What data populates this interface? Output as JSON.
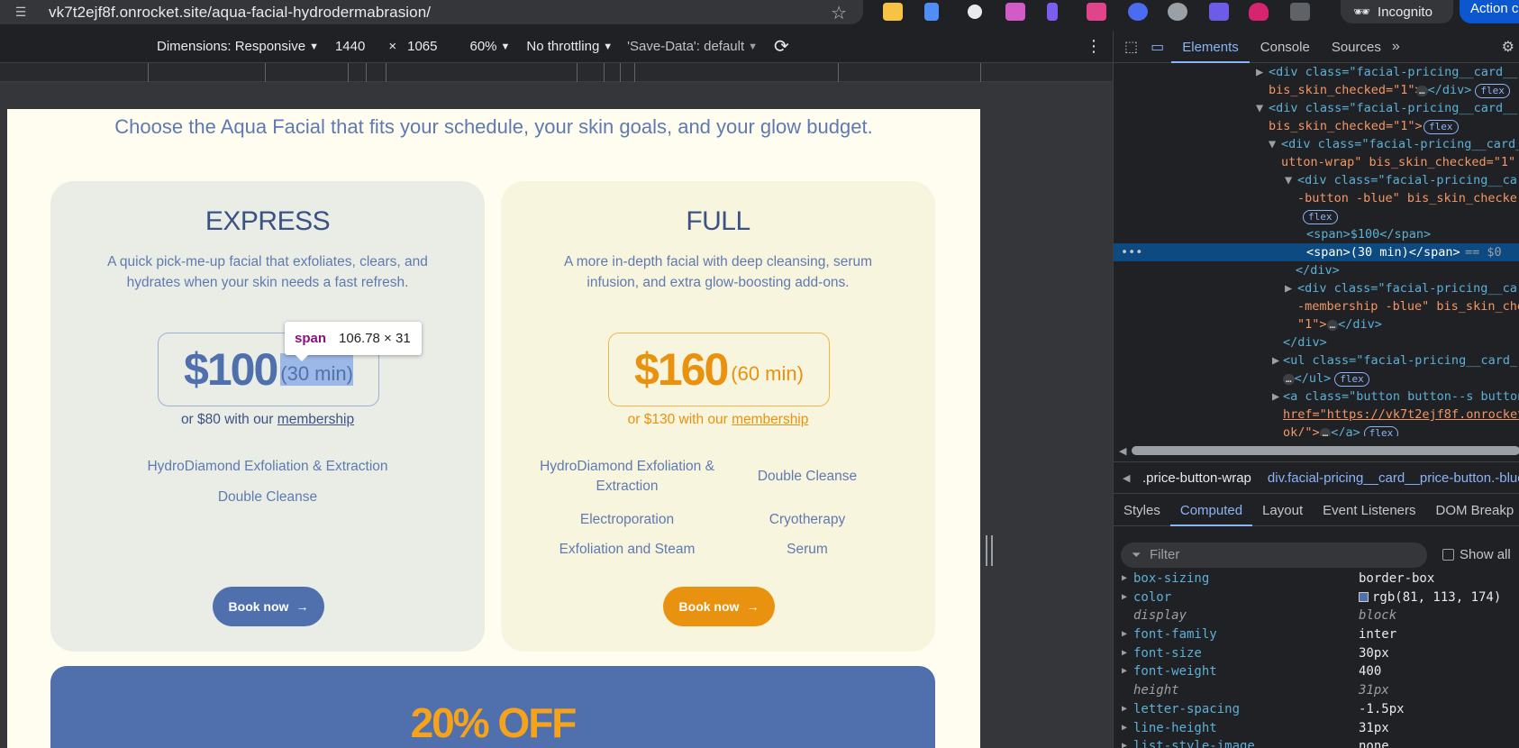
{
  "browser": {
    "url": "vk7t2ejf8f.onrocket.site/aqua-facial-hydrodermabrasion/",
    "incognito_label": "Incognito",
    "action_label": "Action c"
  },
  "device_toolbar": {
    "dimensions": "Dimensions: Responsive",
    "width": "1440",
    "times": "×",
    "height": "1065",
    "zoom": "60%",
    "throttling": "No throttling",
    "save_data": "'Save-Data': default"
  },
  "page": {
    "lede": "Choose the Aqua Facial that fits your schedule, your skin goals, and your glow budget.",
    "express": {
      "title": "EXPRESS",
      "desc": "A quick pick-me-up facial that exfoliates, clears, and hydrates when your skin needs a fast refresh.",
      "price": "$100",
      "duration": "(30 min)",
      "member_prefix": "or $80 with our",
      "member_link": "membership",
      "features": [
        "HydroDiamond Exfoliation & Extraction",
        "Double Cleanse"
      ],
      "book": "Book now"
    },
    "full": {
      "title": "FULL",
      "desc": "A more in-depth facial with deep cleansing, serum infusion, and extra glow-boosting add-ons.",
      "price": "$160",
      "duration": "(60 min)",
      "member_prefix": "or $130 with our",
      "member_link": "membership",
      "features": [
        "HydroDiamond Exfoliation & Extraction",
        "Double Cleanse",
        "Electroporation",
        "Cryotherapy",
        "Exfoliation and Steam",
        "Serum"
      ],
      "book": "Book now"
    },
    "promo": "20% OFF"
  },
  "tooltip": {
    "tag": "span",
    "size": "106.78 × 31"
  },
  "devtools": {
    "tabs": [
      "Elements",
      "Console",
      "Sources"
    ],
    "breadcrumb_1": ".price-button-wrap",
    "breadcrumb_2": "div.facial-pricing__card__price-button.-blue",
    "sub_tabs": [
      "Styles",
      "Computed",
      "Layout",
      "Event Listeners",
      "DOM Breakp"
    ],
    "filter_placeholder": "Filter",
    "show_all": "Show all",
    "computed": [
      {
        "name": "box-sizing",
        "value": "border-box"
      },
      {
        "name": "color",
        "value": "rgb(81, 113, 174)"
      },
      {
        "name": "display",
        "value": "block"
      },
      {
        "name": "font-family",
        "value": "inter"
      },
      {
        "name": "font-size",
        "value": "30px"
      },
      {
        "name": "font-weight",
        "value": "400"
      },
      {
        "name": "height",
        "value": "31px"
      },
      {
        "name": "letter-spacing",
        "value": "-1.5px"
      },
      {
        "name": "line-height",
        "value": "31px"
      },
      {
        "name": "list-style-image",
        "value": "none"
      }
    ],
    "dom": {
      "l1_a": "<div class=\"facial-pricing__card__",
      "l1_b": "bis_skin_checked=\"1\">",
      "l1_c": "</div>",
      "l2_a": "<div class=\"facial-pricing__card__",
      "l2_b": "bis_skin_checked=\"1\">",
      "l3_a": "<div class=\"facial-pricing__card_",
      "l3_b": "utton-wrap\" bis_skin_checked=\"1\"",
      "l4_a": "<div class=\"facial-pricing__car",
      "l4_b": "-button -blue\" bis_skin_checke",
      "l5": "<span>$100</span>",
      "l6": "<span>(30 min)</span>",
      "l6_eq": "== $0",
      "l7": "</div>",
      "l8_a": "<div class=\"facial-pricing__car",
      "l8_b": "-membership -blue\" bis_skin_che",
      "l8_c": "\"1\">",
      "l8_d": "</div>",
      "l9": "</div>",
      "l10_a": "<ul class=\"facial-pricing__card_",
      "l10_b": "</ul>",
      "l11_a": "<a class=\"button button--s button",
      "l11_b": "href=\"https://vk7t2ejf8f.onrocket",
      "l11_c": "ok/\">",
      "l11_d": "</a>",
      "flex": "flex",
      "ellipsis": "…"
    }
  }
}
